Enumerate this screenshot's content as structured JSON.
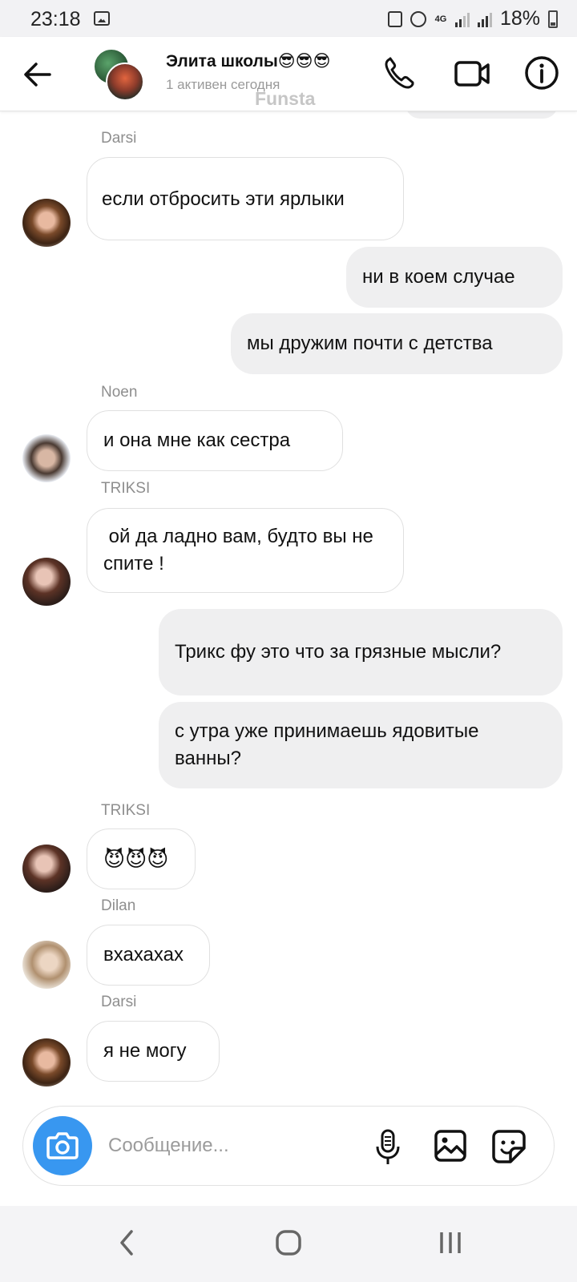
{
  "status_bar": {
    "time": "23:18",
    "network": "4G",
    "battery": "18%"
  },
  "header": {
    "title": "Элита школы😎😎😎",
    "subtitle": "1 активен сегодня",
    "watermark": "Funsta"
  },
  "messages": [
    {
      "sender": "Darsi",
      "text": "если отбросить эти ярлыки",
      "direction": "incoming"
    },
    {
      "text": "ни в коем случае",
      "direction": "outgoing"
    },
    {
      "text": "мы дружим почти с детства",
      "direction": "outgoing"
    },
    {
      "sender": "Noen",
      "text": "и она мне как сестра",
      "direction": "incoming"
    },
    {
      "sender": "TRIKSI",
      "text": " ой да ладно вам, будто вы не спите !",
      "direction": "incoming"
    },
    {
      "text": "Трикс фу это что за грязные мысли?",
      "direction": "outgoing"
    },
    {
      "text": "с утра уже принимаешь ядовитые ванны?",
      "direction": "outgoing"
    },
    {
      "sender": "TRIKSI",
      "text": "😈😈😈",
      "direction": "incoming"
    },
    {
      "sender": "Dilan",
      "text": "вхахахах",
      "direction": "incoming"
    },
    {
      "sender": "Darsi",
      "text": "я не могу",
      "direction": "incoming"
    }
  ],
  "composer": {
    "placeholder": "Сообщение..."
  },
  "colors": {
    "accent": "#3897f0",
    "outgoing_bubble": "#efeff0",
    "incoming_border": "#e0e0e0"
  }
}
